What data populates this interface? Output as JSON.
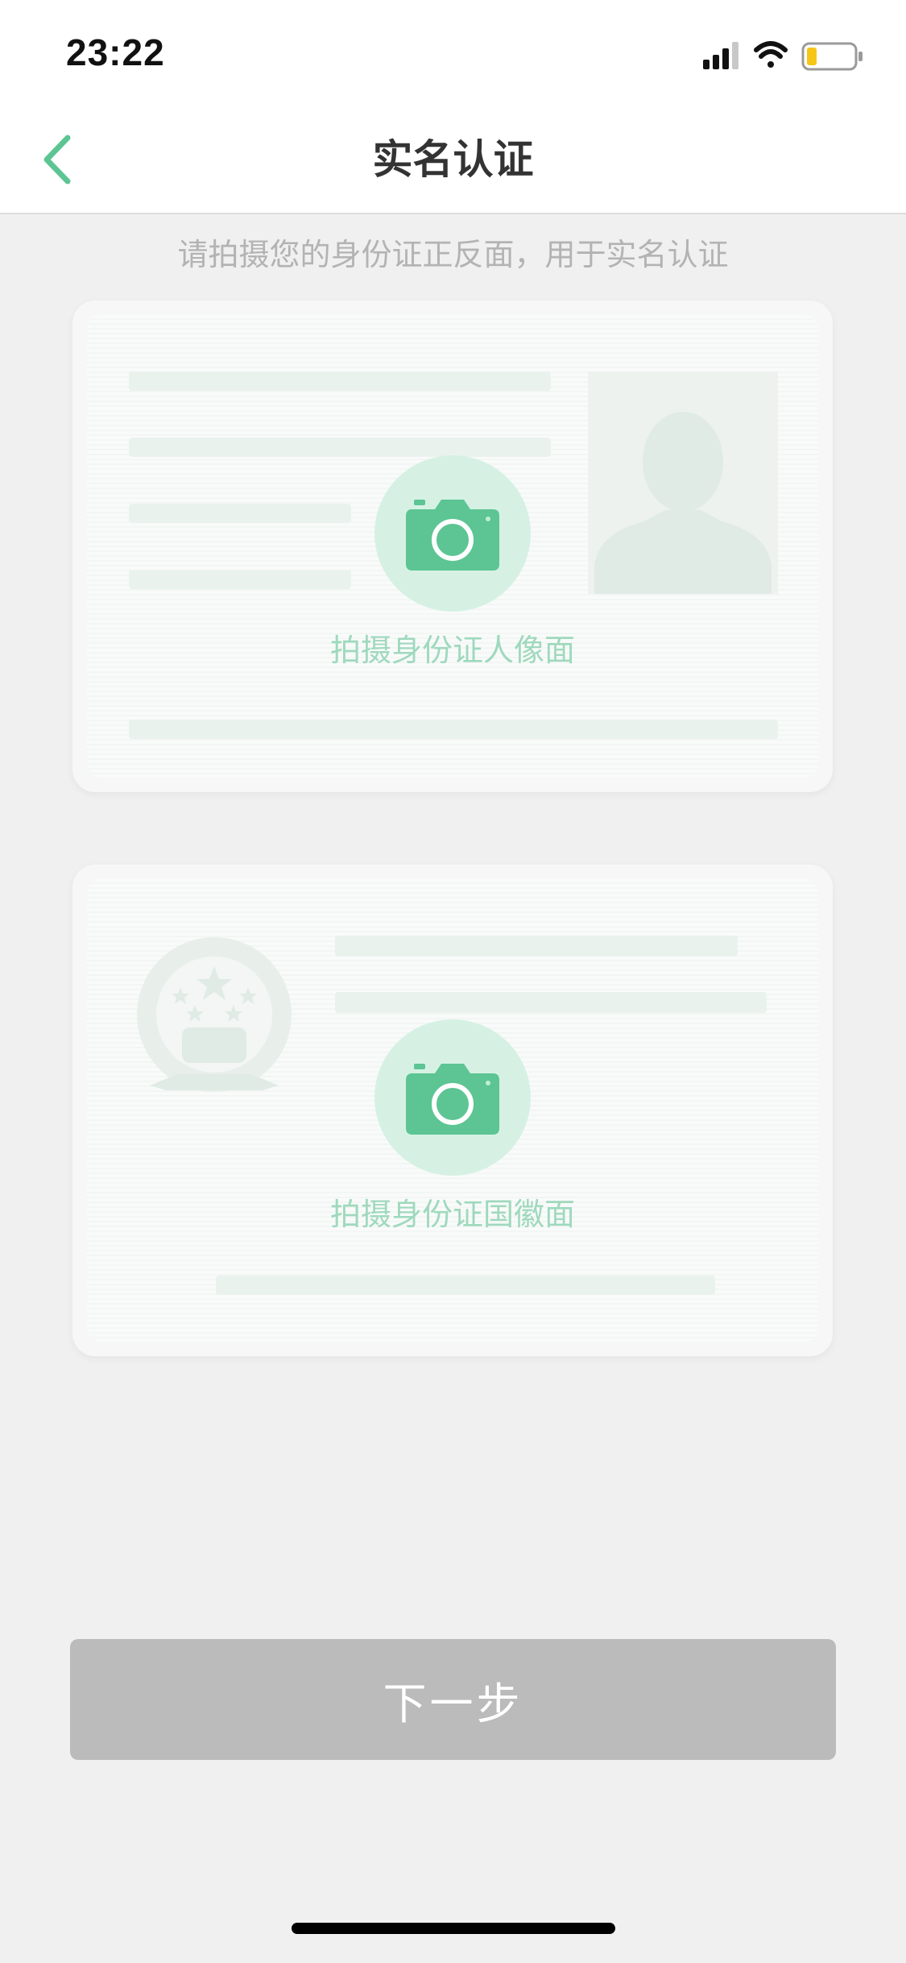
{
  "status_bar": {
    "time": "23:22",
    "icons": [
      "cellular-signal-icon",
      "wifi-icon",
      "battery-icon"
    ]
  },
  "nav": {
    "title": "实名认证",
    "back_icon": "chevron-left-icon"
  },
  "hint": "请拍摄您的身份证正反面，用于实名认证",
  "cards": {
    "front": {
      "label": "拍摄身份证人像面",
      "icon": "camera-icon"
    },
    "back": {
      "label": "拍摄身份证国徽面",
      "icon": "camera-icon"
    }
  },
  "next_button": {
    "label": "下一步"
  },
  "colors": {
    "accent": "#5cc593",
    "accent_light": "#d6f1e4",
    "label_green": "#9fd9bd",
    "button_disabled": "#bbbbbb",
    "background": "#f0f0f0"
  }
}
